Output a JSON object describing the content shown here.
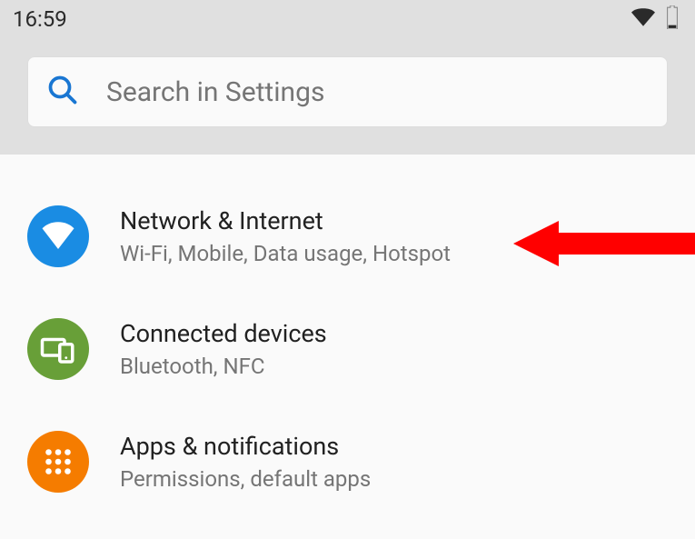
{
  "status_bar": {
    "time": "16:59"
  },
  "search": {
    "placeholder": "Search in Settings"
  },
  "items": [
    {
      "title": "Network & Internet",
      "subtitle": "Wi-Fi, Mobile, Data usage, Hotspot",
      "icon": "wifi",
      "color": "blue"
    },
    {
      "title": "Connected devices",
      "subtitle": "Bluetooth, NFC",
      "icon": "devices",
      "color": "green"
    },
    {
      "title": "Apps & notifications",
      "subtitle": "Permissions, default apps",
      "icon": "apps",
      "color": "orange"
    }
  ]
}
